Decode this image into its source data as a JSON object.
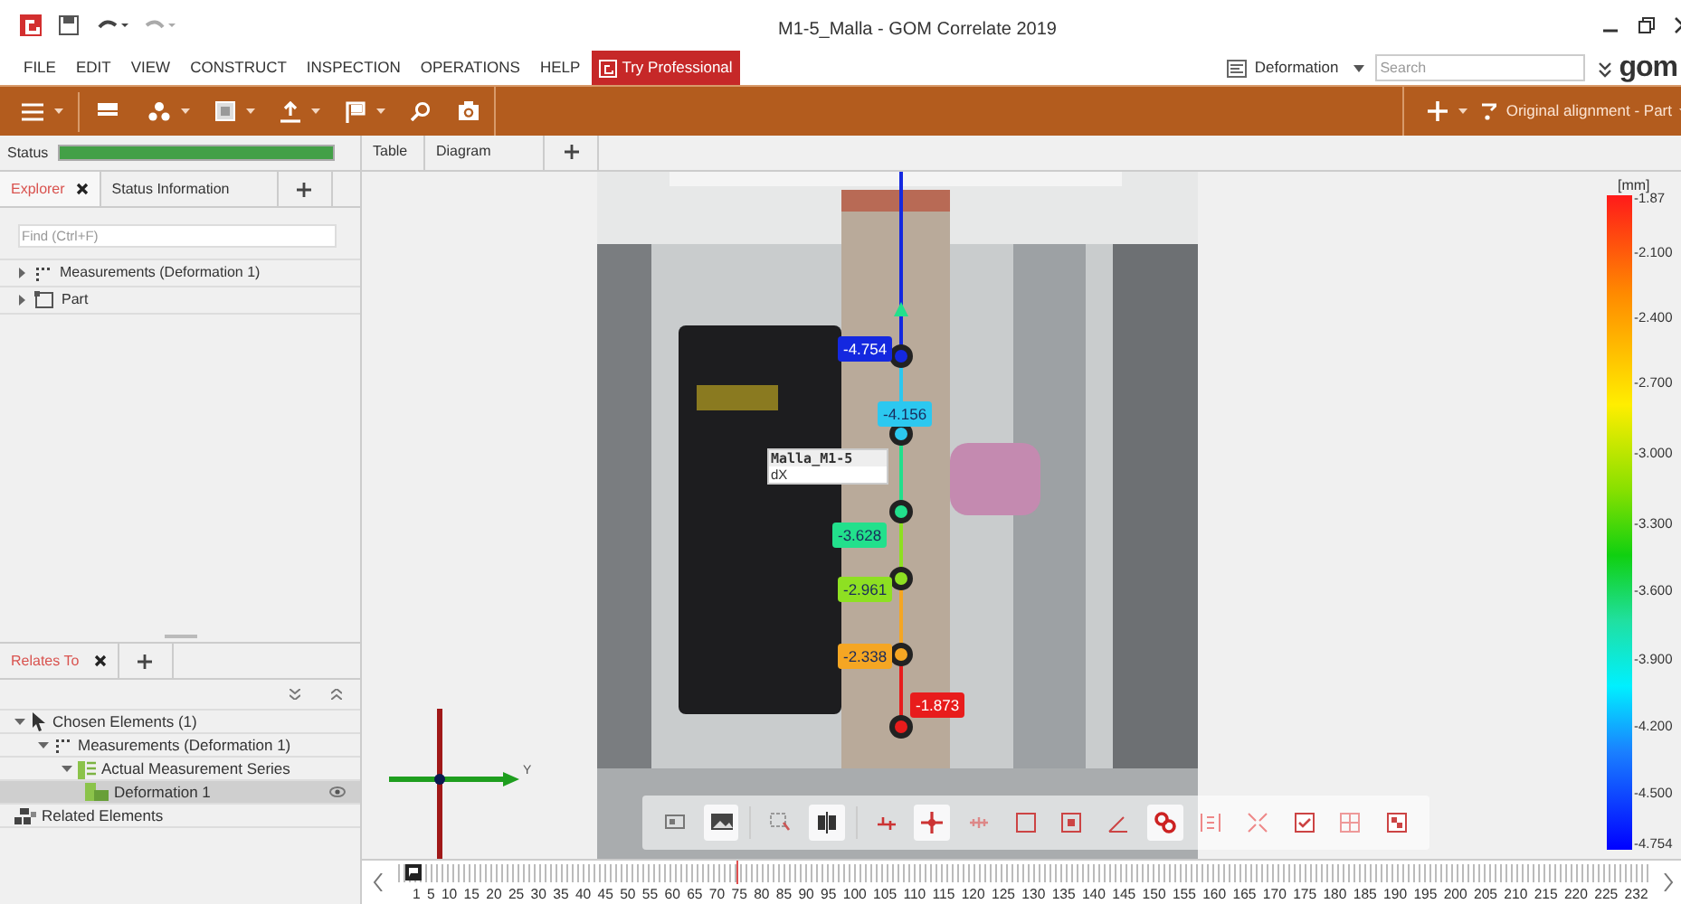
{
  "window": {
    "title": "M1-5_Malla - GOM Correlate 2019"
  },
  "menu": [
    "FILE",
    "EDIT",
    "VIEW",
    "CONSTRUCT",
    "INSPECTION",
    "OPERATIONS",
    "HELP"
  ],
  "try_button": {
    "label": "Try Professional"
  },
  "workspace": {
    "label": "Deformation"
  },
  "search": {
    "placeholder": "Search"
  },
  "logo": {
    "text": "gom"
  },
  "toolbar": {
    "alignment": "Original alignment - Part"
  },
  "status": {
    "label": "Status",
    "level": 1
  },
  "view_tabs": [
    {
      "label": "Table"
    },
    {
      "label": "Diagram"
    }
  ],
  "explorer": {
    "tabs": [
      {
        "label": "Explorer",
        "selected": true
      },
      {
        "label": "Status Information",
        "selected": false
      }
    ],
    "find_placeholder": "Find (Ctrl+F)",
    "items": [
      {
        "label": "Measurements (Deformation 1)",
        "kind": "points",
        "expanded": false
      },
      {
        "label": "Part",
        "kind": "part",
        "expanded": false
      }
    ]
  },
  "relates": {
    "tab": {
      "label": "Relates To"
    },
    "items": [
      {
        "label": "Chosen Elements (1)",
        "kind": "pointer",
        "expanded": true,
        "selected": false,
        "children": [
          {
            "label": "Measurements (Deformation 1)",
            "kind": "points",
            "expanded": true,
            "selected": false,
            "children": [
              {
                "label": "Actual Measurement Series",
                "kind": "series",
                "expanded": true,
                "selected": false,
                "children": [
                  {
                    "label": "Deformation 1",
                    "kind": "stage",
                    "selected": true,
                    "visible": true
                  }
                ]
              }
            ]
          }
        ]
      },
      {
        "label": "Related Elements",
        "kind": "related",
        "selected": false
      }
    ]
  },
  "viewport": {
    "callout": {
      "title": "Malla_M1-5",
      "field": "dX"
    },
    "points": [
      {
        "value": "-4.754",
        "color": "#1428e0"
      },
      {
        "value": "-4.156",
        "color": "#2cc8f0"
      },
      {
        "value": "-3.628",
        "color": "#22e08c"
      },
      {
        "value": "-2.961",
        "color": "#8ee022"
      },
      {
        "value": "-2.338",
        "color": "#f5a623"
      },
      {
        "value": "-1.873",
        "color": "#e81c1c"
      }
    ],
    "axis_label": "Y"
  },
  "legend": {
    "unit": "[mm]",
    "ticks": [
      "-1.87",
      "-2.100",
      "-2.400",
      "-2.700",
      "-3.000",
      "-3.300",
      "-3.600",
      "-3.900",
      "-4.200",
      "-4.500",
      "-4.754"
    ]
  },
  "timeline": {
    "labels": [
      "1",
      "5",
      "10",
      "15",
      "20",
      "25",
      "30",
      "35",
      "40",
      "45",
      "50",
      "55",
      "60",
      "65",
      "70",
      "75",
      "80",
      "85",
      "90",
      "95",
      "100",
      "105",
      "110",
      "115",
      "120",
      "125",
      "130",
      "135",
      "140",
      "145",
      "150",
      "155",
      "160",
      "165",
      "170",
      "175",
      "180",
      "185",
      "190",
      "195",
      "200",
      "205",
      "210",
      "215",
      "220",
      "225",
      "232"
    ],
    "cursor": {
      "level": 0.27
    }
  }
}
